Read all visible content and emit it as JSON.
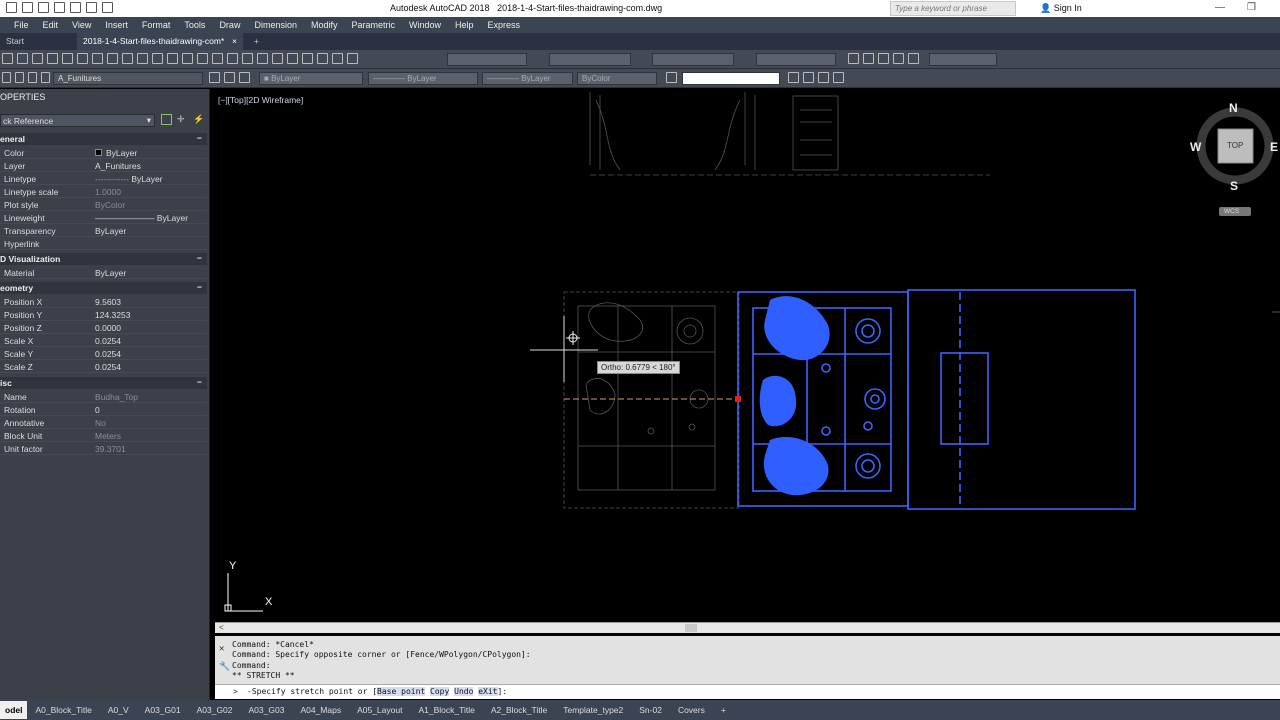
{
  "title": {
    "app": "Autodesk AutoCAD 2018",
    "file": "2018-1-4-Start-files-thaidrawing-com.dwg",
    "search_placeholder": "Type a keyword or phrase",
    "sign_in": "Sign In"
  },
  "menu": [
    "File",
    "Edit",
    "View",
    "Insert",
    "Format",
    "Tools",
    "Draw",
    "Dimension",
    "Modify",
    "Parametric",
    "Window",
    "Help",
    "Express"
  ],
  "doc_tabs": {
    "start": "Start",
    "file": "2018-1-4-Start-files-thaidrawing-com*",
    "close": "×",
    "add": "+"
  },
  "toolbar": {
    "layer": "A_Funitures",
    "color": "ByLayer",
    "linetype": "ByLayer",
    "lineweight": "ByLayer",
    "plotstyle": "ByColor"
  },
  "properties": {
    "header": "OPERTIES",
    "selection": "ck Reference",
    "general": {
      "title": "eneral",
      "rows": [
        {
          "k": "Color",
          "v": "ByLayer"
        },
        {
          "k": "Layer",
          "v": "A_Funitures"
        },
        {
          "k": "Linetype",
          "v": "ByLayer"
        },
        {
          "k": "Linetype scale",
          "v": "1.0000"
        },
        {
          "k": "Plot style",
          "v": "ByColor"
        },
        {
          "k": "Lineweight",
          "v": "ByLayer"
        },
        {
          "k": "Transparency",
          "v": "ByLayer"
        },
        {
          "k": "Hyperlink",
          "v": ""
        }
      ]
    },
    "visualization": {
      "title": "D Visualization",
      "rows": [
        {
          "k": "Material",
          "v": "ByLayer"
        }
      ]
    },
    "geometry": {
      "title": "eometry",
      "rows": [
        {
          "k": "Position X",
          "v": "9.5603"
        },
        {
          "k": "Position Y",
          "v": "124.3253"
        },
        {
          "k": "Position Z",
          "v": "0.0000"
        },
        {
          "k": "Scale X",
          "v": "0.0254"
        },
        {
          "k": "Scale Y",
          "v": "0.0254"
        },
        {
          "k": "Scale Z",
          "v": "0.0254"
        }
      ]
    },
    "misc": {
      "title": "isc",
      "rows": [
        {
          "k": "Name",
          "v": "Budha_Top"
        },
        {
          "k": "Rotation",
          "v": "0"
        },
        {
          "k": "Annotative",
          "v": "No"
        },
        {
          "k": "Block Unit",
          "v": "Meters"
        },
        {
          "k": "Unit factor",
          "v": "39.3701"
        }
      ]
    },
    "minus": "−"
  },
  "viewport": {
    "label": "[−][Top][2D Wireframe]",
    "tooltip": "Ortho: 0.6779 < 180°",
    "viewcube": {
      "n": "N",
      "s": "S",
      "e": "E",
      "w": "W",
      "top": "TOP",
      "wcs": "WCS"
    },
    "ucs": {
      "x": "X",
      "y": "Y"
    }
  },
  "command": {
    "history": [
      "Command: *Cancel*",
      "Command: Specify opposite corner or [Fence/WPolygon/CPolygon]:",
      "Command:",
      "** STRETCH **"
    ],
    "prompt_pre": "-Specify stretch point or [",
    "opt1": "Base point",
    "opt2": "Copy",
    "opt3": "Undo",
    "opt4": "eXit",
    "prompt_post": "]:"
  },
  "layouts": [
    "odel",
    "A0_Block_Title",
    "A0_V",
    "A03_G01",
    "A03_G02",
    "A03_G03",
    "A04_Maps",
    "A05_Layout",
    "A1_Block_Title",
    "A2_Block_Title",
    "Template_type2",
    "Sn-02",
    "Covers",
    "+"
  ]
}
